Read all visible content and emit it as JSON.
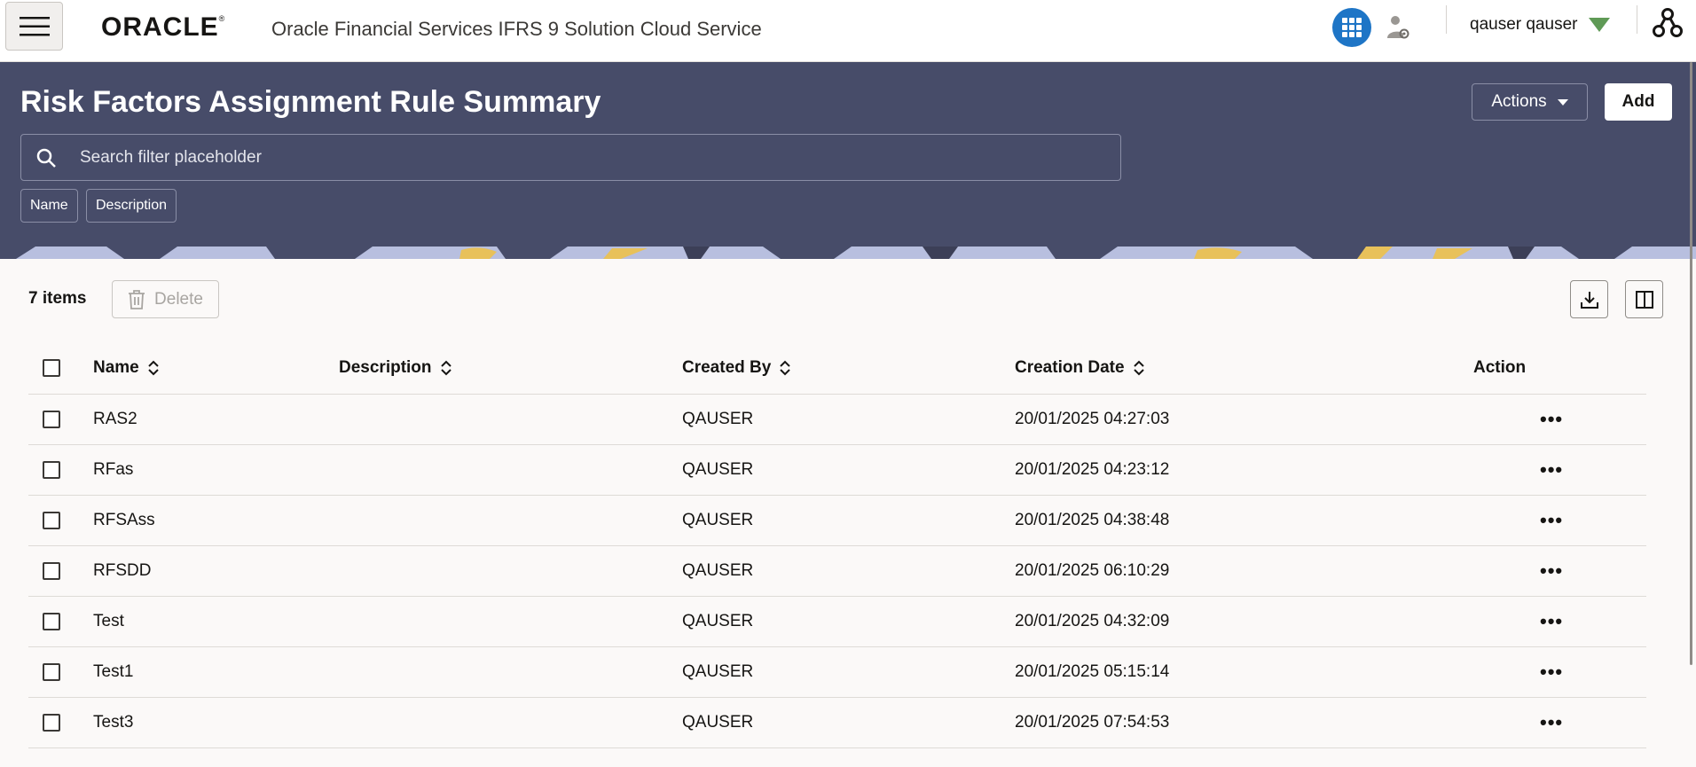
{
  "header": {
    "brand": "ORACLE",
    "brand_mark": "®",
    "app_title": "Oracle Financial Services IFRS 9 Solution Cloud Service",
    "user_name": "qauser qauser"
  },
  "page": {
    "title": "Risk Factors Assignment Rule Summary",
    "actions_label": "Actions",
    "add_label": "Add",
    "search_placeholder": "Search filter placeholder",
    "filter_chips": [
      "Name",
      "Description"
    ]
  },
  "toolbar": {
    "items_count": "7 items",
    "delete_label": "Delete"
  },
  "table": {
    "columns": [
      "Name",
      "Description",
      "Created By",
      "Creation Date",
      "Action"
    ],
    "rows": [
      {
        "name": "RAS2",
        "description": "",
        "created_by": "QAUSER",
        "creation_date": "20/01/2025 04:27:03"
      },
      {
        "name": "RFas",
        "description": "",
        "created_by": "QAUSER",
        "creation_date": "20/01/2025 04:23:12"
      },
      {
        "name": "RFSAss",
        "description": "",
        "created_by": "QAUSER",
        "creation_date": "20/01/2025 04:38:48"
      },
      {
        "name": "RFSDD",
        "description": "",
        "created_by": "QAUSER",
        "creation_date": "20/01/2025 06:10:29"
      },
      {
        "name": "Test",
        "description": "",
        "created_by": "QAUSER",
        "creation_date": "20/01/2025 04:32:09"
      },
      {
        "name": "Test1",
        "description": "",
        "created_by": "QAUSER",
        "creation_date": "20/01/2025 05:15:14"
      },
      {
        "name": "Test3",
        "description": "",
        "created_by": "QAUSER",
        "creation_date": "20/01/2025 07:54:53"
      }
    ],
    "row_action_glyph": "•••"
  },
  "icons": {
    "menu": "hamburger-menu-icon",
    "apps": "app-grid-icon",
    "user_settings": "user-settings-icon",
    "user_menu": "caret-down-icon",
    "network": "network-icon",
    "search": "search-icon",
    "delete": "trash-icon",
    "download": "download-icon",
    "columns": "columns-icon",
    "sort": "sort-icon"
  },
  "colors": {
    "band": "#474c69",
    "accent_blue": "#1e75c6",
    "caret_green": "#5f9a56",
    "page_bg": "#fbf9f8"
  }
}
